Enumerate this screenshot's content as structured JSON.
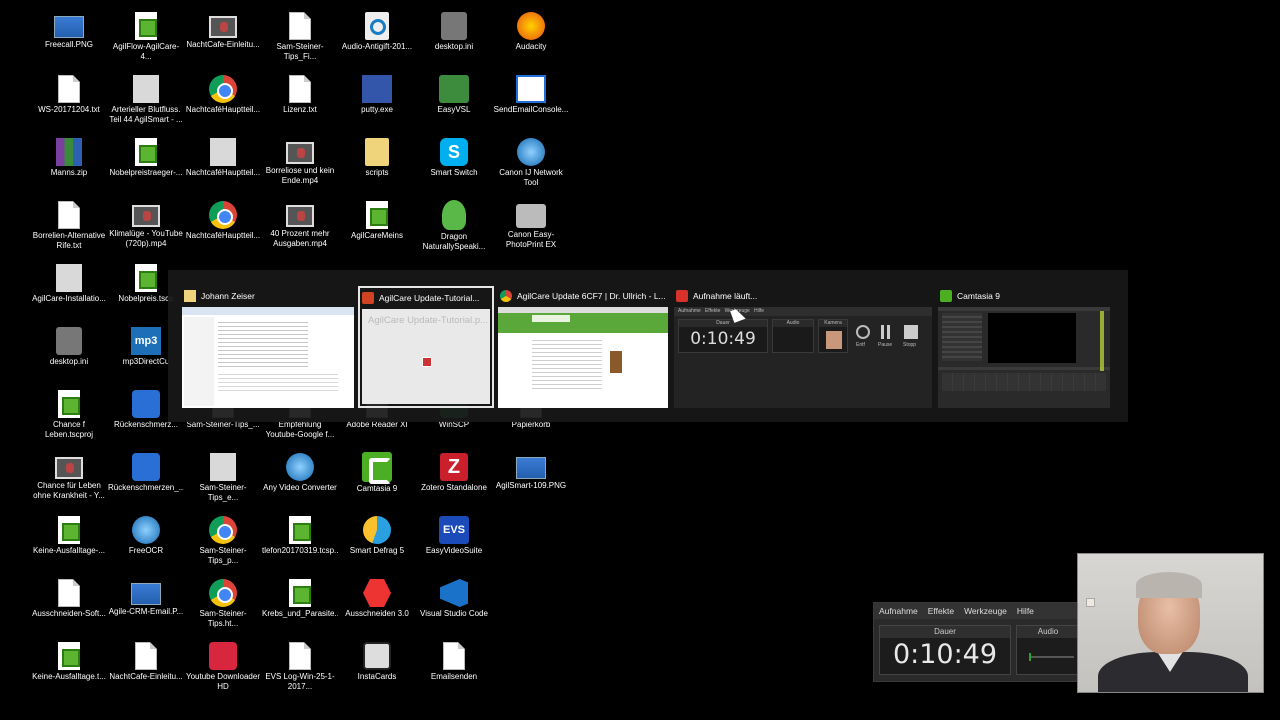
{
  "desktop_icons": [
    {
      "label": "Freecall.PNG",
      "icon": "png"
    },
    {
      "label": "AgilFlow-AgilCare-4...",
      "icon": "proj"
    },
    {
      "label": "NachtCafe-Einleitu...",
      "icon": "video"
    },
    {
      "label": "Sam-Steiner-Tips_Fi...",
      "icon": "doc"
    },
    {
      "label": "Audio-Antigift-201...",
      "icon": "antigift"
    },
    {
      "label": "desktop.ini",
      "icon": "gear"
    },
    {
      "label": "Audacity",
      "icon": "audacity"
    },
    {
      "label": "WS-20171204.txt",
      "icon": "doc"
    },
    {
      "label": "Arterieller Blutfluss. Teil 44 AgilSmart - ...",
      "icon": "scan"
    },
    {
      "label": "NachtcaféHauptteil...",
      "icon": "chrome"
    },
    {
      "label": "Lizenz.txt",
      "icon": "doc"
    },
    {
      "label": "putty.exe",
      "icon": "putty"
    },
    {
      "label": "EasyVSL",
      "icon": "easyvsl"
    },
    {
      "label": "SendEmailConsole...",
      "icon": "sendmail"
    },
    {
      "label": "Manns.zip",
      "icon": "wrar"
    },
    {
      "label": "Nobelpreistraeger-...",
      "icon": "proj"
    },
    {
      "label": "NachtcaféHauptteil...",
      "icon": "scan"
    },
    {
      "label": "Borreliose und kein Ende.mp4",
      "icon": "video"
    },
    {
      "label": "scripts",
      "icon": "folder"
    },
    {
      "label": "Smart Switch",
      "icon": "skype"
    },
    {
      "label": "Canon IJ Network Tool",
      "icon": "globe"
    },
    {
      "label": "Borrelien-Alternative Rife.txt",
      "icon": "doc"
    },
    {
      "label": "Klimalüge - YouTube (720p).mp4",
      "icon": "video"
    },
    {
      "label": "NachtcaféHauptteil...",
      "icon": "chrome"
    },
    {
      "label": "40 Prozent mehr Ausgaben.mp4",
      "icon": "video"
    },
    {
      "label": "AgilCareMeins",
      "icon": "proj"
    },
    {
      "label": "Dragon NaturallySpeaki...",
      "icon": "dragon"
    },
    {
      "label": "Canon Easy-PhotoPrint EX",
      "icon": "canon"
    },
    {
      "label": "AgilCare-Installatio...",
      "icon": "scan"
    },
    {
      "label": "Nobelpreis.tscp",
      "icon": "proj"
    },
    {
      "label": "desktop.ini",
      "icon": "gear"
    },
    {
      "label": "mp3DirectCu",
      "icon": "mp3"
    },
    {
      "label": "Chance f Leben.tscproj",
      "icon": "proj"
    },
    {
      "label": "Rückenschmerz...",
      "icon": "blue"
    },
    {
      "label": "Sam-Steiner-Tips_...",
      "icon": "doc"
    },
    {
      "label": "Empfehlung Youtube-Google f...",
      "icon": "doc"
    },
    {
      "label": "Adobe Reader XI",
      "icon": "doc"
    },
    {
      "label": "WinSCP",
      "icon": "green"
    },
    {
      "label": "Papierkorb",
      "icon": "doc"
    },
    {
      "label": "Chance für Leben ohne Krankheit - Y...",
      "icon": "video"
    },
    {
      "label": "Rückenschmerzen_...",
      "icon": "blue"
    },
    {
      "label": "Sam-Steiner-Tips_e...",
      "icon": "scan"
    },
    {
      "label": "Any Video Converter",
      "icon": "globe"
    },
    {
      "label": "Camtasia 9",
      "icon": "camtasia"
    },
    {
      "label": "Zotero Standalone",
      "icon": "zotero"
    },
    {
      "label": "AgilSmart-109.PNG",
      "icon": "png"
    },
    {
      "label": "Keine-Ausfalltage-...",
      "icon": "proj"
    },
    {
      "label": "FreeOCR",
      "icon": "globe"
    },
    {
      "label": "Sam-Steiner-Tips_p...",
      "icon": "chrome"
    },
    {
      "label": "tlefon20170319.tcsp...",
      "icon": "proj"
    },
    {
      "label": "Smart Defrag 5",
      "icon": "defrag"
    },
    {
      "label": "EasyVideoSuite",
      "icon": "evs"
    },
    {
      "label": "Ausschneiden-Soft...",
      "icon": "doc"
    },
    {
      "label": "Agile-CRM-Email.P...",
      "icon": "png"
    },
    {
      "label": "Sam-Steiner-Tips.ht...",
      "icon": "chrome"
    },
    {
      "label": "Krebs_und_Parasite...",
      "icon": "proj"
    },
    {
      "label": "Ausschneiden 3.0",
      "icon": "ausschneiden"
    },
    {
      "label": "Visual Studio Code",
      "icon": "vscode"
    },
    {
      "label": "Keine-Ausfalltage.t...",
      "icon": "proj"
    },
    {
      "label": "NachtCafe-Einleitu...",
      "icon": "doc"
    },
    {
      "label": "Youtube Downloader HD",
      "icon": "ytdl"
    },
    {
      "label": "EVS Log-Win-25-1-2017...",
      "icon": "doc"
    },
    {
      "label": "InstaCards",
      "icon": "instacards"
    },
    {
      "label": "Emailsenden",
      "icon": "doc"
    }
  ],
  "switcher": {
    "tasks": [
      {
        "title": "Johann Zeiser",
        "app_icon": "folder-icon",
        "selected": false
      },
      {
        "title": "AgilCare Update-Tutorial...",
        "app_icon": "powerpoint-icon",
        "selected": true,
        "thumb_text": "AgilCare Update-Tutorial.p..."
      },
      {
        "title": "AgilCare Update 6CF7 | Dr. Ullrich - L...",
        "app_icon": "chrome-icon",
        "selected": false
      },
      {
        "title": "Aufnahme läuft...",
        "app_icon": "camtasia-recorder-icon",
        "selected": false,
        "thumb_time": "0:10:49"
      },
      {
        "title": "Camtasia 9",
        "app_icon": "camtasia-icon",
        "selected": false
      }
    ]
  },
  "recorder": {
    "menu": [
      "Aufnahme",
      "Effekte",
      "Werkzeuge",
      "Hilfe"
    ],
    "duration_label": "Dauer",
    "time": "0:10:49",
    "audio_label": "Audio"
  },
  "thumb_recorder": {
    "menu": [
      "Aufnahme",
      "Effekte",
      "Werkzeuge",
      "Hilfe"
    ],
    "labels": [
      "Dauer",
      "Audio",
      "Kamera"
    ],
    "buttons": [
      "Entf",
      "Pause",
      "Stopp"
    ]
  },
  "colors": {
    "desktop_bg": "#000000",
    "switcher_bg": "#181818",
    "selected_border": "#e6e6e6",
    "camtasia_green": "#4caf23"
  }
}
